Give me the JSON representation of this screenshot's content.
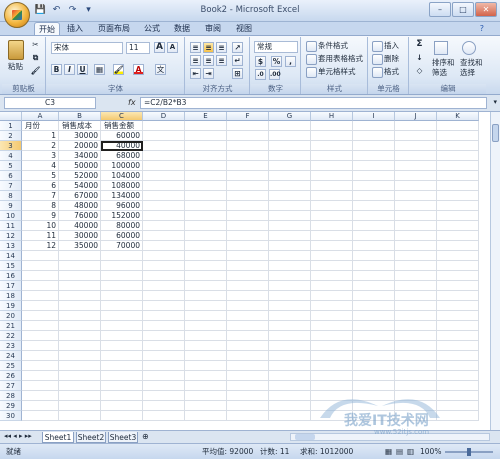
{
  "window": {
    "title": "Book2 - Microsoft Excel"
  },
  "qat": {
    "save": "💾",
    "undo": "↶",
    "redo": "↷",
    "more": "▾"
  },
  "tabs": [
    "开始",
    "插入",
    "页面布局",
    "公式",
    "数据",
    "审阅",
    "视图"
  ],
  "ribbon": {
    "clipboard": {
      "label": "剪贴板",
      "paste": "粘贴"
    },
    "font": {
      "label": "字体",
      "name": "宋体",
      "size": "11",
      "grow": "A",
      "shrink": "A",
      "bold": "B",
      "italic": "I",
      "underline": "U",
      "border": "▦",
      "fill": "🖌",
      "color": "A",
      "phonetic": "文"
    },
    "alignment": {
      "label": "对齐方式"
    },
    "number": {
      "label": "数字",
      "format": "常规",
      "currency": "$",
      "percent": "%",
      "comma": ","
    },
    "styles": {
      "label": "样式",
      "conditional": "条件格式",
      "table": "套用表格格式",
      "cell": "单元格样式"
    },
    "cells": {
      "label": "单元格",
      "insert": "插入",
      "delete": "删除",
      "format": "格式"
    },
    "editing": {
      "label": "编辑",
      "sum": "Σ",
      "fill": "↓",
      "clear": "◇",
      "sort": "排序和",
      "sort2": "筛选",
      "find": "查找和",
      "find2": "选择"
    }
  },
  "formula_bar": {
    "name_box": "C3",
    "fx": "fx",
    "formula": "=C2/B2*B3"
  },
  "columns": [
    "A",
    "B",
    "C",
    "D",
    "E",
    "F",
    "G",
    "H",
    "I",
    "J",
    "K"
  ],
  "rows": [
    "1",
    "2",
    "3",
    "4",
    "5",
    "6",
    "7",
    "8",
    "9",
    "10",
    "11",
    "12",
    "13",
    "14",
    "15",
    "16",
    "17",
    "18",
    "19",
    "20",
    "21",
    "22",
    "23",
    "24",
    "25",
    "26",
    "27",
    "28",
    "29",
    "30"
  ],
  "table": {
    "headers": [
      "月份",
      "销售成本",
      "销售金额"
    ],
    "data": [
      [
        "1",
        "30000",
        "60000"
      ],
      [
        "2",
        "20000",
        "40000"
      ],
      [
        "3",
        "34000",
        "68000"
      ],
      [
        "4",
        "50000",
        "100000"
      ],
      [
        "5",
        "52000",
        "104000"
      ],
      [
        "6",
        "54000",
        "108000"
      ],
      [
        "7",
        "67000",
        "134000"
      ],
      [
        "8",
        "48000",
        "96000"
      ],
      [
        "9",
        "76000",
        "152000"
      ],
      [
        "10",
        "40000",
        "80000"
      ],
      [
        "11",
        "30000",
        "60000"
      ],
      [
        "12",
        "35000",
        "70000"
      ]
    ]
  },
  "sheets": [
    "Sheet1",
    "Sheet2",
    "Sheet3"
  ],
  "status": {
    "ready": "就绪",
    "average": "平均值: 92000",
    "count": "计数: 11",
    "sum": "求和: 1012000",
    "zoom": "100%"
  },
  "watermark": {
    "text": "我爱IT技术网",
    "url": "www.52itjs.com"
  },
  "colors": {
    "accent": "#2f69c6",
    "ribbon": "#dbe5f1",
    "border": "#9fb3d2"
  }
}
